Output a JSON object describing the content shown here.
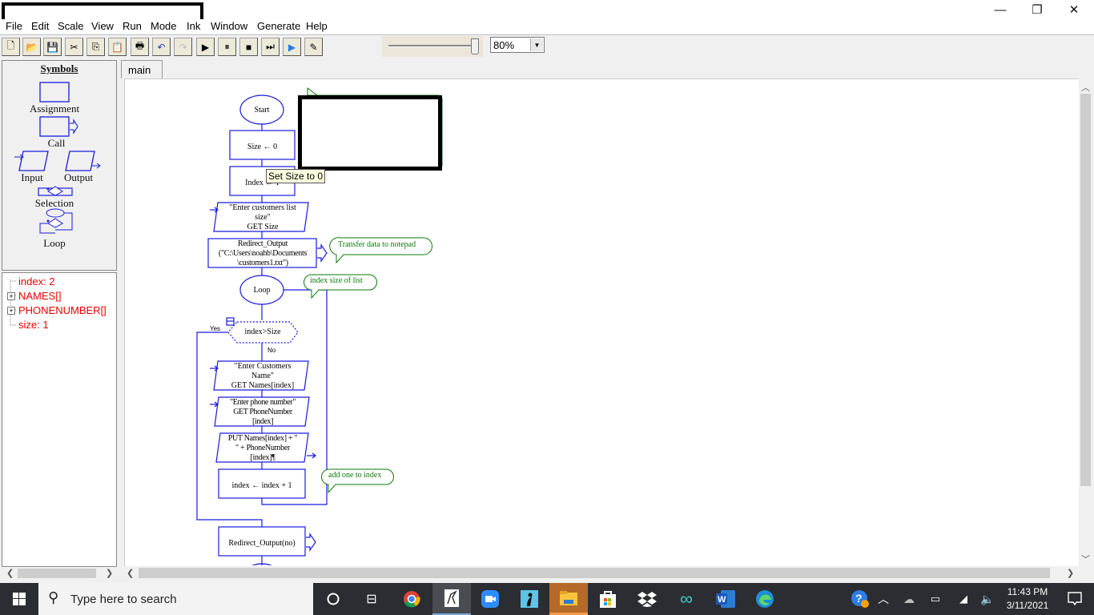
{
  "window": {
    "title_redacted": true,
    "controls": {
      "minimize": "—",
      "restore": "❐",
      "close": "✕"
    }
  },
  "menu": [
    "File",
    "Edit",
    "Scale",
    "View",
    "Run",
    "Mode",
    "Ink",
    "Window",
    "Generate",
    "Help"
  ],
  "toolbar": {
    "buttons": [
      {
        "name": "new-icon",
        "glyph": "🗋"
      },
      {
        "name": "open-icon",
        "glyph": "📂"
      },
      {
        "name": "save-icon",
        "glyph": "💾"
      },
      {
        "name": "cut-icon",
        "glyph": "✂"
      },
      {
        "name": "copy-icon",
        "glyph": "⎘"
      },
      {
        "name": "paste-icon",
        "glyph": "📋"
      },
      {
        "name": "print-icon",
        "glyph": "🖶"
      },
      {
        "name": "undo-icon",
        "glyph": "↶"
      },
      {
        "name": "redo-icon",
        "glyph": "↷"
      },
      {
        "name": "run-icon",
        "glyph": "▶"
      },
      {
        "name": "pause-icon",
        "glyph": "⏸"
      },
      {
        "name": "stop-icon",
        "glyph": "■"
      },
      {
        "name": "step-icon",
        "glyph": "⏭"
      },
      {
        "name": "test-server-icon",
        "glyph": "▶"
      },
      {
        "name": "ink-pen-icon",
        "glyph": "✎"
      }
    ],
    "speed_slider_value": 1.0,
    "zoom_value": "80%"
  },
  "symbols": {
    "title": "Symbols",
    "items": [
      "Assignment",
      "Call",
      "Input",
      "Output",
      "Selection",
      "Loop"
    ]
  },
  "variables": [
    {
      "label": "index: 2",
      "expandable": false
    },
    {
      "label": "NAMES[]",
      "expandable": true
    },
    {
      "label": "PHONENUMBER[]",
      "expandable": true
    },
    {
      "label": "size: 1",
      "expandable": false
    }
  ],
  "tabs": [
    {
      "label": "main",
      "active": true
    }
  ],
  "flowchart": {
    "start": "Start",
    "assign_size": "Size ← 0",
    "assign_index": "Index ← 1",
    "input1": [
      "\"Enter customers list",
      "size\"",
      "GET Size"
    ],
    "call_redirect": [
      "Redirect_Output",
      "(\"C:\\Users\\noahb\\Documents",
      "\\customers1.txt\")"
    ],
    "loop": "Loop",
    "condition": "index>Size",
    "yes": "Yes",
    "no": "No",
    "input2": [
      "\"Enter Customers",
      "Name\"",
      "GET Names[index]"
    ],
    "input3": [
      "\"Enter phone number\"",
      "GET PhoneNumber",
      "[index]"
    ],
    "output1": [
      "PUT Names[index] + \"",
      "\" + PhoneNumber",
      "[index]¶"
    ],
    "assign_increment": "index ← index + 1",
    "call_redirect_off": "Redirect_Output(no)",
    "comments": {
      "transfer": "Transfer data to notepad",
      "index_size": "index size of list",
      "add_one": "add one to index"
    },
    "tooltip": "Set Size to 0"
  },
  "taskbar": {
    "search_placeholder": "Type here to search",
    "time": "11:43 PM",
    "date": "3/11/2021"
  },
  "colors": {
    "flow_blue": "#1a1adf",
    "comment_green": "#0a7a0a",
    "variable_red": "#ee0000",
    "taskbar_bg": "#2b2d32"
  }
}
